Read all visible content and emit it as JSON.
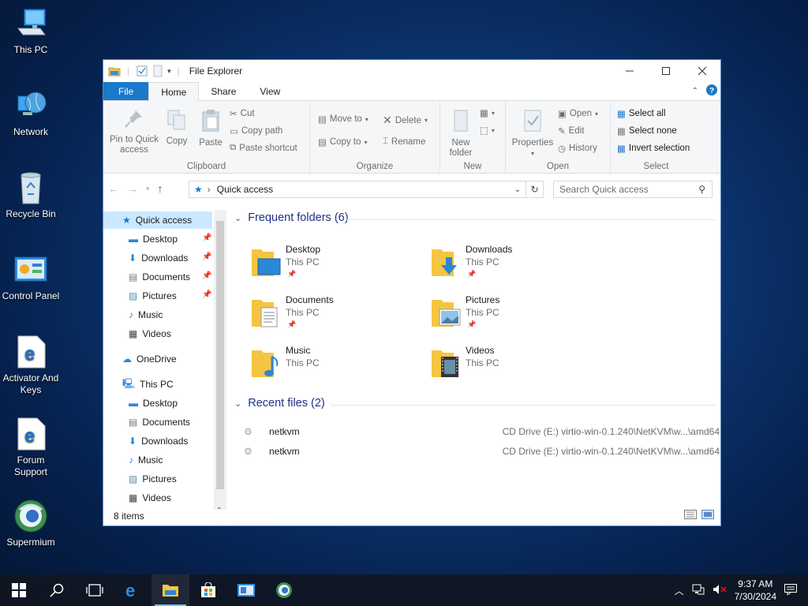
{
  "desktop": {
    "icons": [
      {
        "label": "This PC",
        "icon": "computer-icon"
      },
      {
        "label": "Network",
        "icon": "network-globe-icon"
      },
      {
        "label": "Recycle Bin",
        "icon": "recycle-bin-icon"
      },
      {
        "label": "Control Panel",
        "icon": "control-panel-icon"
      },
      {
        "label": "Activator And Keys",
        "icon": "edge-shortcut-icon"
      },
      {
        "label": "Forum Support",
        "icon": "edge-shortcut-icon"
      },
      {
        "label": "Supermium",
        "icon": "supermium-browser-icon"
      }
    ]
  },
  "window": {
    "title": "File Explorer",
    "tabs": [
      "File",
      "Home",
      "Share",
      "View"
    ]
  },
  "ribbon": {
    "clipboard": {
      "label": "Clipboard",
      "pin": "Pin to Quick access",
      "pin_l1": "Pin to Quick",
      "pin_l2": "access",
      "copy": "Copy",
      "paste": "Paste",
      "cut": "Cut",
      "copy_path": "Copy path",
      "paste_shortcut": "Paste shortcut"
    },
    "organize": {
      "label": "Organize",
      "move_to": "Move to",
      "copy_to": "Copy to",
      "delete": "Delete",
      "rename": "Rename"
    },
    "new": {
      "label": "New",
      "new_folder_l1": "New",
      "new_folder_l2": "folder"
    },
    "open": {
      "label": "Open",
      "properties": "Properties",
      "open": "Open",
      "edit": "Edit",
      "history": "History"
    },
    "select": {
      "label": "Select",
      "select_all": "Select all",
      "select_none": "Select none",
      "invert": "Invert selection"
    }
  },
  "address": {
    "location": "Quick access",
    "search_placeholder": "Search Quick access"
  },
  "nav": {
    "quick_access": "Quick access",
    "quick_items": [
      "Desktop",
      "Downloads",
      "Documents",
      "Pictures",
      "Music",
      "Videos"
    ],
    "onedrive": "OneDrive",
    "this_pc": "This PC",
    "pc_items": [
      "Desktop",
      "Documents",
      "Downloads",
      "Music",
      "Pictures",
      "Videos"
    ]
  },
  "content": {
    "frequent_header": "Frequent folders (6)",
    "folders": [
      {
        "name": "Desktop",
        "loc": "This PC",
        "pinned": true
      },
      {
        "name": "Downloads",
        "loc": "This PC",
        "pinned": true
      },
      {
        "name": "Documents",
        "loc": "This PC",
        "pinned": true
      },
      {
        "name": "Pictures",
        "loc": "This PC",
        "pinned": true
      },
      {
        "name": "Music",
        "loc": "This PC",
        "pinned": false
      },
      {
        "name": "Videos",
        "loc": "This PC",
        "pinned": false
      }
    ],
    "recent_header": "Recent files (2)",
    "recent": [
      {
        "name": "netkvm",
        "path": "CD Drive (E:) virtio-win-0.1.240\\NetKVM\\w...\\amd64"
      },
      {
        "name": "netkvm",
        "path": "CD Drive (E:) virtio-win-0.1.240\\NetKVM\\w...\\amd64"
      }
    ]
  },
  "status": {
    "items": "8 items"
  },
  "taskbar": {
    "time": "9:37 AM",
    "date": "7/30/2024"
  },
  "colors": {
    "accent": "#1979ca",
    "selection": "#cce8ff",
    "folder": "#f5c542"
  }
}
